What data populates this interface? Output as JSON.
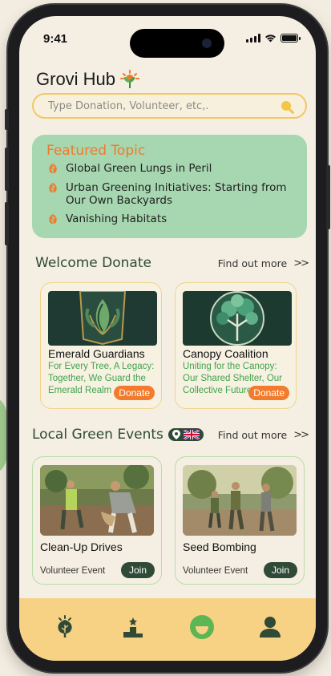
{
  "status": {
    "time": "9:41"
  },
  "app": {
    "title": "Grovi Hub"
  },
  "search": {
    "placeholder": "Type Donation, Volunteer, etc,."
  },
  "featured": {
    "heading": "Featured Topic",
    "topics": [
      "Global Green Lungs in Peril",
      "Urban Greening Initiatives: Starting from Our Own Backyards",
      "Vanishing Habitats"
    ]
  },
  "donate": {
    "title": "Welcome Donate",
    "find_more": "Find out more",
    "cards": [
      {
        "name": "Emerald Guardians",
        "desc_lines": [
          "For Every Tree, A Legacy:",
          "Together, We Guard the",
          "Emerald Realm"
        ],
        "button": "Donate"
      },
      {
        "name": "Canopy Coalition",
        "desc_lines": [
          "Uniting for the Canopy:",
          "Our Shared Shelter, Our",
          "Collective Future"
        ],
        "button": "Donate"
      }
    ]
  },
  "events": {
    "title": "Local Green Events",
    "find_more": "Find out more",
    "cards": [
      {
        "name": "Clean-Up Drives",
        "type": "Volunteer Event",
        "button": "Join"
      },
      {
        "name": "Seed Bombing",
        "type": "Volunteer Event",
        "button": "Join"
      }
    ]
  },
  "nav": {
    "items": [
      "leaf-icon",
      "leaderboard-icon",
      "smile-icon",
      "profile-icon"
    ],
    "active": "smile-icon"
  },
  "colors": {
    "accent_orange": "#f27b2d",
    "dark_green": "#2f4a36",
    "featured_bg": "#a7d7b0",
    "nav_bg": "#f7d184",
    "desc_green": "#3fa34d"
  }
}
